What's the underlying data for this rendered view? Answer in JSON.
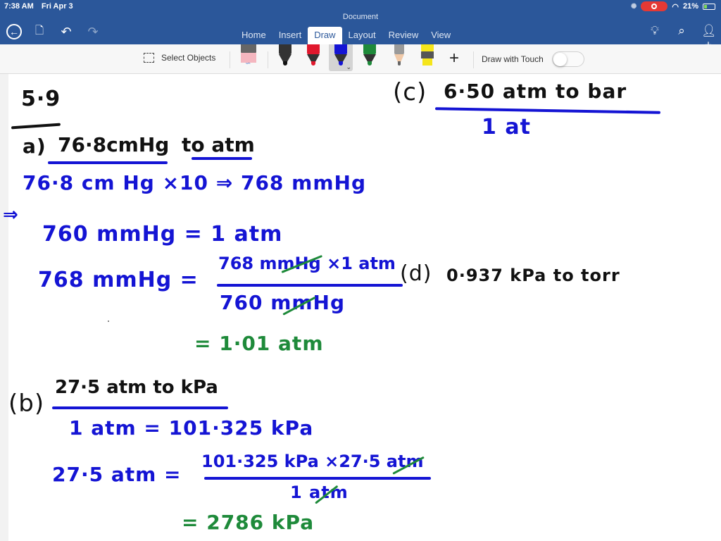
{
  "status_bar": {
    "time": "7:38 AM",
    "date": "Fri Apr 3",
    "battery": "21%"
  },
  "window": {
    "title": "Document"
  },
  "tabs": [
    {
      "label": "Home",
      "active": false
    },
    {
      "label": "Insert",
      "active": false
    },
    {
      "label": "Draw",
      "active": true
    },
    {
      "label": "Layout",
      "active": false
    },
    {
      "label": "Review",
      "active": false
    },
    {
      "label": "View",
      "active": false
    }
  ],
  "icons": {
    "back": "back-arrow-icon",
    "file": "file-icon",
    "undo": "undo-icon",
    "redo": "redo-icon",
    "lightbulb": "lightbulb-icon",
    "search": "search-icon",
    "share": "add-person-icon"
  },
  "ribbon": {
    "select_objects": "Select Objects",
    "draw_with_touch": "Draw with Touch",
    "draw_with_touch_on": false,
    "pens": [
      {
        "name": "eraser",
        "color": "#f4b6bf"
      },
      {
        "name": "black-pen",
        "color": "#111111"
      },
      {
        "name": "red-pen",
        "color": "#e0182d"
      },
      {
        "name": "blue-pen",
        "color": "#1414d4",
        "selected": true
      },
      {
        "name": "green-pen",
        "color": "#1e8a3a"
      },
      {
        "name": "pencil",
        "color": "#9a9a9a"
      },
      {
        "name": "highlighter",
        "color": "#f5e51b"
      }
    ]
  },
  "colors": {
    "brand": "#2b579a",
    "ink_black": "#111111",
    "ink_blue": "#1414d4",
    "ink_green": "#1e8a3a"
  },
  "notes": {
    "heading": "5·9",
    "part_a": {
      "label": "a)",
      "prompt_1": "76·8cmHg",
      "prompt_2": "to atm",
      "line1": "76·8 cm Hg ×10 ⇒ 768 mmHg",
      "arrow": "⇒",
      "line2": "760 mmHg = 1 atm",
      "lhs": "768 mmHg =",
      "numerator": "768 mmHg ×1 atm",
      "denominator": "760 mmHg",
      "result": "= 1·01 atm"
    },
    "part_b": {
      "label": "(b)",
      "prompt": "27·5 atm to kPa",
      "line1": "1 atm = 101·325 kPa",
      "lhs": "27·5 atm =",
      "numerator": "101·325 kPa ×27·5 atm",
      "denominator": "1 atm",
      "result": "= 2786 kPa"
    },
    "part_c": {
      "label": "(c)",
      "prompt": "6·50 atm to bar",
      "line1": "1 at"
    },
    "part_d": {
      "label": "(d)",
      "prompt": "0·937 kPa to torr"
    }
  }
}
